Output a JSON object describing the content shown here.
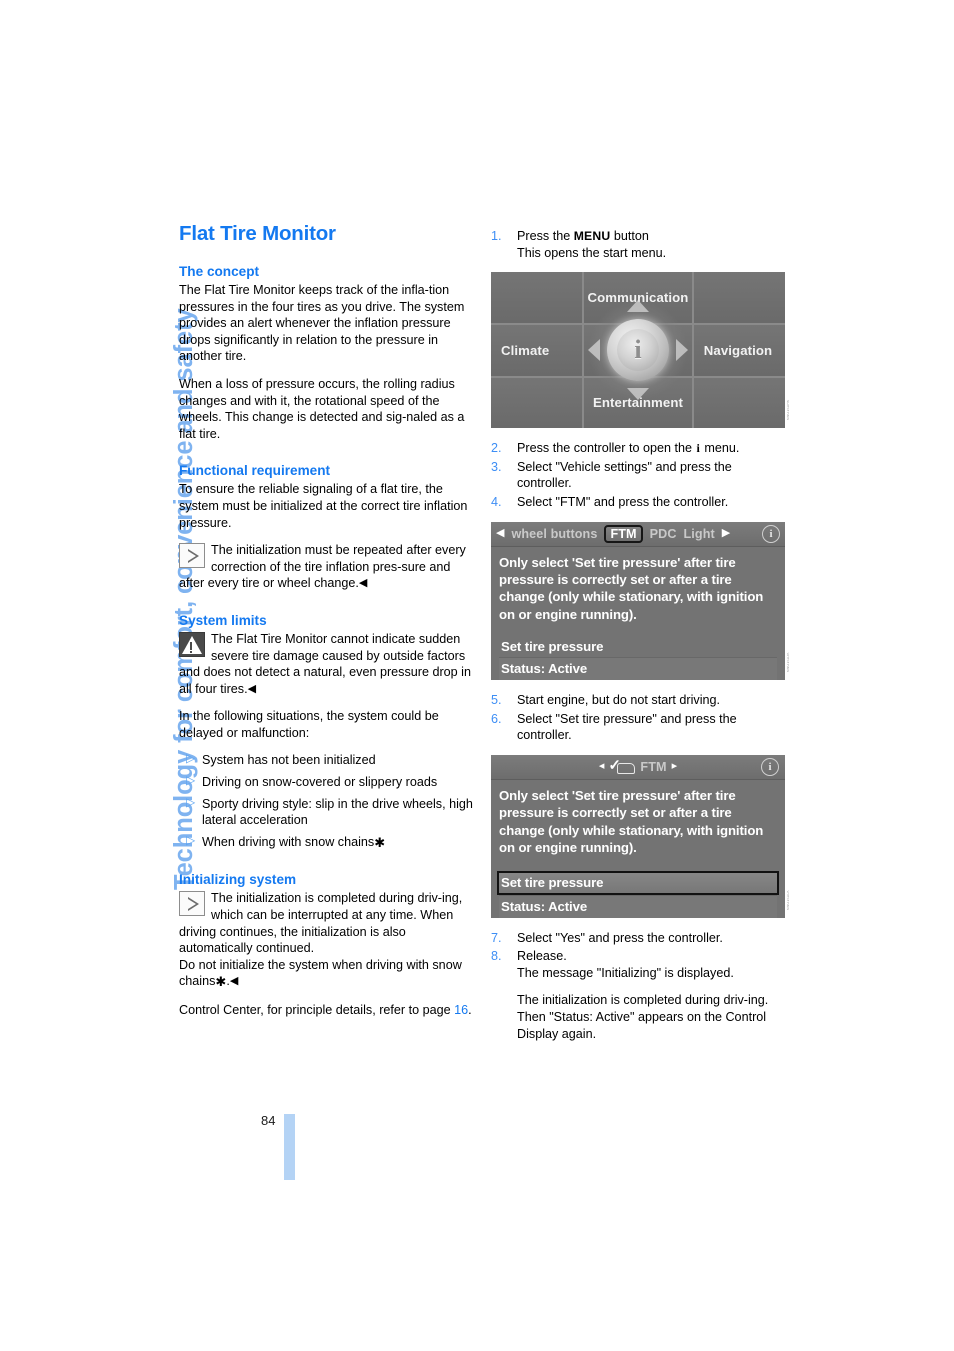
{
  "chapter_tab": "Technology for comfort, convenience and safety",
  "page_number": "84",
  "left_column": {
    "title": "Flat Tire Monitor",
    "concept": {
      "heading": "The concept",
      "paragraph_1": "The Flat Tire Monitor keeps track of the infla-tion pressures in the four tires as you drive. The system provides an alert whenever the inflation pressure drops significantly in relation to the pressure in another tire.",
      "paragraph_2": "When a loss of pressure occurs, the rolling radius changes and with it, the rotational speed of the wheels. This change is detected and sig-naled as a flat tire."
    },
    "functional_requirement": {
      "heading": "Functional requirement",
      "paragraph_1": "To ensure the reliable signaling of a flat tire, the system must be initialized at the correct tire inflation pressure.",
      "note": "The initialization must be repeated after every correction of the tire inflation pres-sure and after every tire or wheel change.",
      "note_end_marker": "◀"
    },
    "system_limits": {
      "heading": "System limits",
      "warning": "The Flat Tire Monitor cannot indicate sudden severe tire damage caused by outside factors and does not detect a natural, even pressure drop in all four tires.",
      "warning_end_marker": "◀",
      "intro": "In the following situations, the system could be delayed or malfunction:",
      "bullets": [
        "System has not been initialized",
        "Driving on snow-covered or slippery roads",
        "Sporty driving style: slip in the drive wheels, high lateral acceleration",
        "When driving with snow chains"
      ],
      "bullet_star_index": 3,
      "star_symbol": "✱"
    },
    "initializing_system": {
      "heading": "Initializing system",
      "note_1": "The initialization is completed during driv-ing, which can be interrupted at any time. When driving continues, the initialization is also automatically continued.",
      "note_2_prefix": "Do not initialize the system when driving with snow chains",
      "note_2_star": "✱",
      "note_2_suffix": ".",
      "note_end_marker": "◀",
      "reference_prefix": "Control Center, for principle details, refer to page ",
      "reference_page": "16",
      "reference_suffix": "."
    }
  },
  "right_column": {
    "steps": [
      {
        "num": "1.",
        "text": "Press the ",
        "bold_word": "MENU",
        "text_after": " button",
        "sub": "This opens the start menu."
      },
      {
        "num": "2.",
        "text_before": "Press the controller to open the ",
        "glyph": "i",
        "text_after": " menu."
      },
      {
        "num": "3.",
        "text": "Select \"Vehicle settings\" and press the controller."
      },
      {
        "num": "4.",
        "text": "Select \"FTM\" and press the controller."
      },
      {
        "num": "5.",
        "text": "Start engine, but do not start driving."
      },
      {
        "num": "6.",
        "text": "Select \"Set tire pressure\" and press the controller."
      },
      {
        "num": "7.",
        "text": "Select \"Yes\" and press the controller."
      },
      {
        "num": "8.",
        "text": "Release.",
        "sub": "The message \"Initializing\" is displayed.",
        "sub2": "The initialization is completed during driv-ing. Then \"Status: Active\" appears on the Control Display again."
      }
    ],
    "start_menu_screenshot": {
      "top_label": "Communication",
      "left_label": "Climate",
      "right_label": "Navigation",
      "bottom_label": "Entertainment",
      "center_glyph": "i",
      "watermark": "MNO1SDHK"
    },
    "ftm_screenshot_1": {
      "tabs": [
        "wheel buttons",
        "FTM",
        "PDC",
        "Light"
      ],
      "selected_tab": "FTM",
      "prev_arrow": "◀",
      "next_arrow": "▶",
      "info_glyph": "i",
      "message": "Only select 'Set tire pressure' after tire pressure is correctly set or after a tire change (only while stationary, with ignition on or engine running).",
      "row_set_pressure": "Set tire pressure",
      "row_status": "Status: Active",
      "selected_row": "",
      "watermark": "MNO1SDJK"
    },
    "ftm_screenshot_2": {
      "title": "FTM",
      "prev_arrow": "◂",
      "next_arrow": "▸",
      "info_glyph": "i",
      "message": "Only select 'Set tire pressure' after tire pressure is correctly set or after a tire change (only while stationary, with ignition on or engine running).",
      "row_set_pressure": "Set tire pressure",
      "row_status": "Status:  Active",
      "selected_row": "Set tire pressure",
      "watermark": "MNO1SDLK"
    }
  },
  "colors": {
    "accent_blue": "#1479f0",
    "step_number_blue": "#3d8ef5",
    "tab_blue": "#7fb3f0",
    "footer_bar_blue": "#b4d3f5",
    "screen_gray": "#6e6e6e"
  }
}
